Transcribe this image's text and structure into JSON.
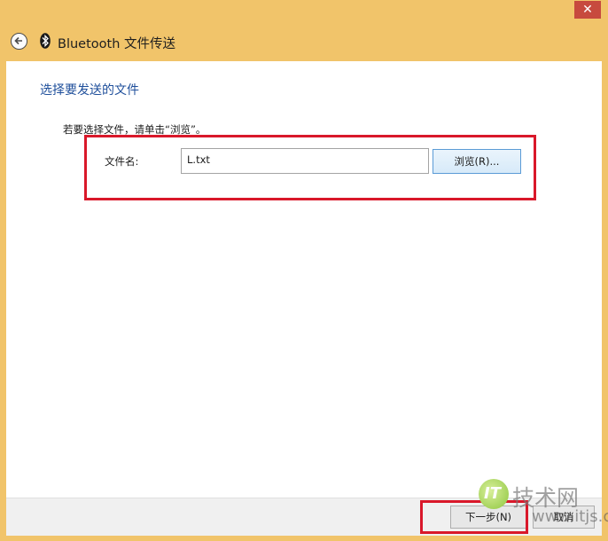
{
  "window": {
    "title": "Bluetooth 文件传送",
    "close_glyph": "✕"
  },
  "main": {
    "heading": "选择要发送的文件",
    "instruction": "若要选择文件，请单击“浏览”。",
    "filename_label": "文件名:",
    "filename_value": "L.txt",
    "browse_label": "浏览(R)..."
  },
  "footer": {
    "next_label": "下一步(N)",
    "cancel_label": "取消"
  },
  "watermark": {
    "logo_text": "IT",
    "site_text": "技术网",
    "url_text": "www.itjs.cn"
  },
  "colors": {
    "frame": "#f1c46a",
    "heading": "#1f4f9b",
    "highlight": "#d9182a",
    "close_button": "#c74a3e"
  }
}
